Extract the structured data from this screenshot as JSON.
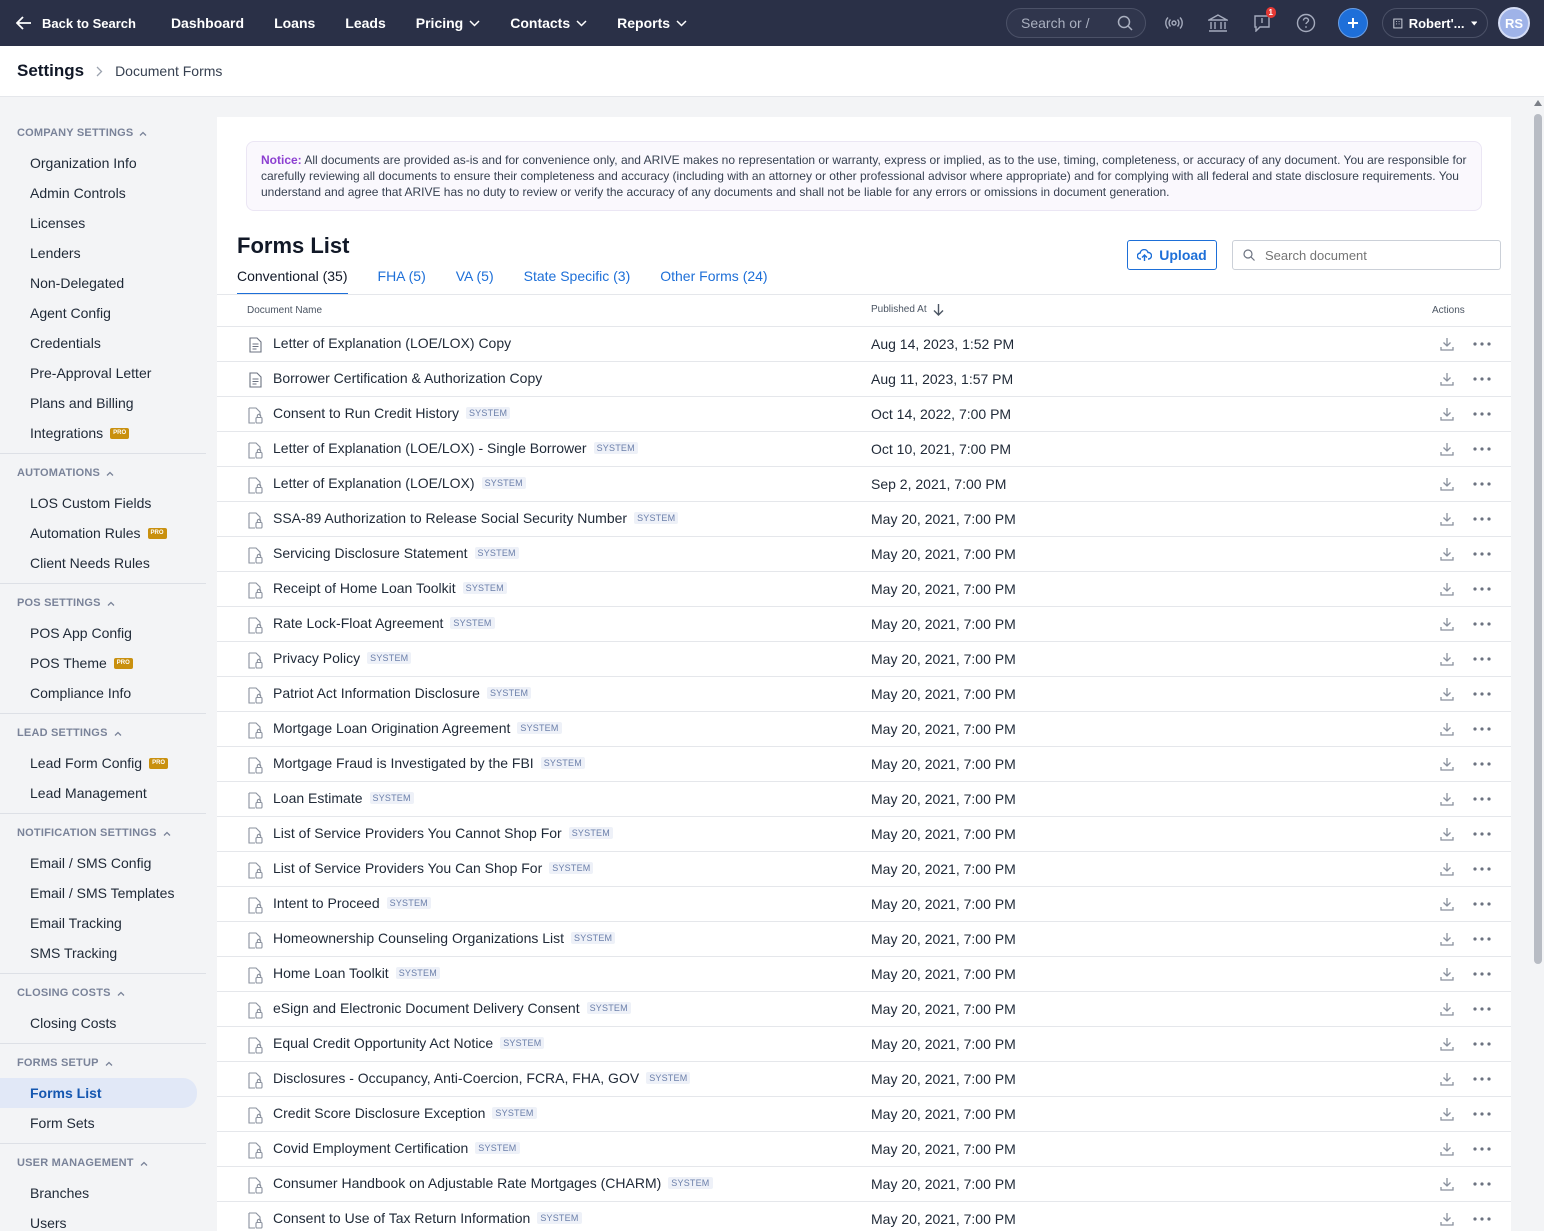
{
  "nav": {
    "back_label": "Back to Search",
    "links": [
      "Dashboard",
      "Loans",
      "Leads",
      "Pricing",
      "Contacts",
      "Reports"
    ],
    "search_placeholder": "Search or /",
    "notification_count": "1",
    "user_label": "Robert'...",
    "avatar_initials": "RS"
  },
  "breadcrumb": {
    "root": "Settings",
    "current": "Document Forms"
  },
  "sidebar": {
    "sections": [
      {
        "title": "Company Settings",
        "items": [
          {
            "label": "Organization Info"
          },
          {
            "label": "Admin Controls"
          },
          {
            "label": "Licenses"
          },
          {
            "label": "Lenders"
          },
          {
            "label": "Non-Delegated"
          },
          {
            "label": "Agent Config"
          },
          {
            "label": "Credentials"
          },
          {
            "label": "Pre-Approval Letter"
          },
          {
            "label": "Plans and Billing"
          },
          {
            "label": "Integrations",
            "pro": true
          }
        ]
      },
      {
        "title": "Automations",
        "items": [
          {
            "label": "LOS Custom Fields"
          },
          {
            "label": "Automation Rules",
            "pro": true
          },
          {
            "label": "Client Needs Rules"
          }
        ]
      },
      {
        "title": "POS Settings",
        "items": [
          {
            "label": "POS App Config"
          },
          {
            "label": "POS Theme",
            "pro": true
          },
          {
            "label": "Compliance Info"
          }
        ]
      },
      {
        "title": "Lead Settings",
        "items": [
          {
            "label": "Lead Form Config",
            "pro": true
          },
          {
            "label": "Lead Management"
          }
        ]
      },
      {
        "title": "Notification Settings",
        "items": [
          {
            "label": "Email / SMS Config"
          },
          {
            "label": "Email / SMS Templates"
          },
          {
            "label": "Email Tracking"
          },
          {
            "label": "SMS Tracking"
          }
        ]
      },
      {
        "title": "Closing Costs",
        "items": [
          {
            "label": "Closing Costs"
          }
        ]
      },
      {
        "title": "Forms Setup",
        "items": [
          {
            "label": "Forms List",
            "active": true
          },
          {
            "label": "Form Sets"
          }
        ]
      },
      {
        "title": "User Management",
        "items": [
          {
            "label": "Branches"
          },
          {
            "label": "Users"
          }
        ]
      }
    ],
    "pro_label": "PRO"
  },
  "notice": {
    "label": "Notice:",
    "text": "All documents are provided as-is and for convenience only, and ARIVE makes no representation or warranty, express or implied, as to the use, timing, completeness, or accuracy of any document. You are responsible for carefully reviewing all documents to ensure their completeness and accuracy (including with an attorney or other professional advisor where appropriate) and for complying with all federal and state disclosure requirements. You understand and agree that ARIVE has no duty to review or verify the accuracy of any documents and shall not be liable for any errors or omissions in document generation."
  },
  "forms": {
    "title": "Forms List",
    "upload_label": "Upload",
    "search_placeholder": "Search document",
    "tabs": [
      {
        "label": "Conventional (35)",
        "active": true
      },
      {
        "label": "FHA (5)"
      },
      {
        "label": "VA (5)"
      },
      {
        "label": "State Specific (3)"
      },
      {
        "label": "Other Forms (24)"
      }
    ],
    "columns": {
      "name": "Document Name",
      "published": "Published At",
      "actions": "Actions"
    },
    "system_label": "SYSTEM",
    "rows": [
      {
        "name": "Letter of Explanation (LOE/LOX) Copy",
        "system": false,
        "date": "Aug 14, 2023, 1:52 PM"
      },
      {
        "name": "Borrower Certification & Authorization Copy",
        "system": false,
        "date": "Aug 11, 2023, 1:57 PM"
      },
      {
        "name": "Consent to Run Credit History",
        "system": true,
        "date": "Oct 14, 2022, 7:00 PM"
      },
      {
        "name": "Letter of Explanation (LOE/LOX) - Single Borrower",
        "system": true,
        "date": "Oct 10, 2021, 7:00 PM"
      },
      {
        "name": "Letter of Explanation (LOE/LOX)",
        "system": true,
        "date": "Sep 2, 2021, 7:00 PM"
      },
      {
        "name": "SSA-89 Authorization to Release Social Security Number",
        "system": true,
        "date": "May 20, 2021, 7:00 PM"
      },
      {
        "name": "Servicing Disclosure Statement",
        "system": true,
        "date": "May 20, 2021, 7:00 PM"
      },
      {
        "name": "Receipt of Home Loan Toolkit",
        "system": true,
        "date": "May 20, 2021, 7:00 PM"
      },
      {
        "name": "Rate Lock-Float Agreement",
        "system": true,
        "date": "May 20, 2021, 7:00 PM"
      },
      {
        "name": "Privacy Policy",
        "system": true,
        "date": "May 20, 2021, 7:00 PM"
      },
      {
        "name": "Patriot Act Information Disclosure",
        "system": true,
        "date": "May 20, 2021, 7:00 PM"
      },
      {
        "name": "Mortgage Loan Origination Agreement",
        "system": true,
        "date": "May 20, 2021, 7:00 PM"
      },
      {
        "name": "Mortgage Fraud is Investigated by the FBI",
        "system": true,
        "date": "May 20, 2021, 7:00 PM"
      },
      {
        "name": "Loan Estimate",
        "system": true,
        "date": "May 20, 2021, 7:00 PM"
      },
      {
        "name": "List of Service Providers You Cannot Shop For",
        "system": true,
        "date": "May 20, 2021, 7:00 PM"
      },
      {
        "name": "List of Service Providers You Can Shop For",
        "system": true,
        "date": "May 20, 2021, 7:00 PM"
      },
      {
        "name": "Intent to Proceed",
        "system": true,
        "date": "May 20, 2021, 7:00 PM"
      },
      {
        "name": "Homeownership Counseling Organizations List",
        "system": true,
        "date": "May 20, 2021, 7:00 PM"
      },
      {
        "name": "Home Loan Toolkit",
        "system": true,
        "date": "May 20, 2021, 7:00 PM"
      },
      {
        "name": "eSign and Electronic Document Delivery Consent",
        "system": true,
        "date": "May 20, 2021, 7:00 PM"
      },
      {
        "name": "Equal Credit Opportunity Act Notice",
        "system": true,
        "date": "May 20, 2021, 7:00 PM"
      },
      {
        "name": "Disclosures - Occupancy, Anti-Coercion, FCRA, FHA, GOV",
        "system": true,
        "date": "May 20, 2021, 7:00 PM"
      },
      {
        "name": "Credit Score Disclosure Exception",
        "system": true,
        "date": "May 20, 2021, 7:00 PM"
      },
      {
        "name": "Covid Employment Certification",
        "system": true,
        "date": "May 20, 2021, 7:00 PM"
      },
      {
        "name": "Consumer Handbook on Adjustable Rate Mortgages (CHARM)",
        "system": true,
        "date": "May 20, 2021, 7:00 PM"
      },
      {
        "name": "Consent to Use of Tax Return Information",
        "system": true,
        "date": "May 20, 2021, 7:00 PM"
      }
    ]
  }
}
